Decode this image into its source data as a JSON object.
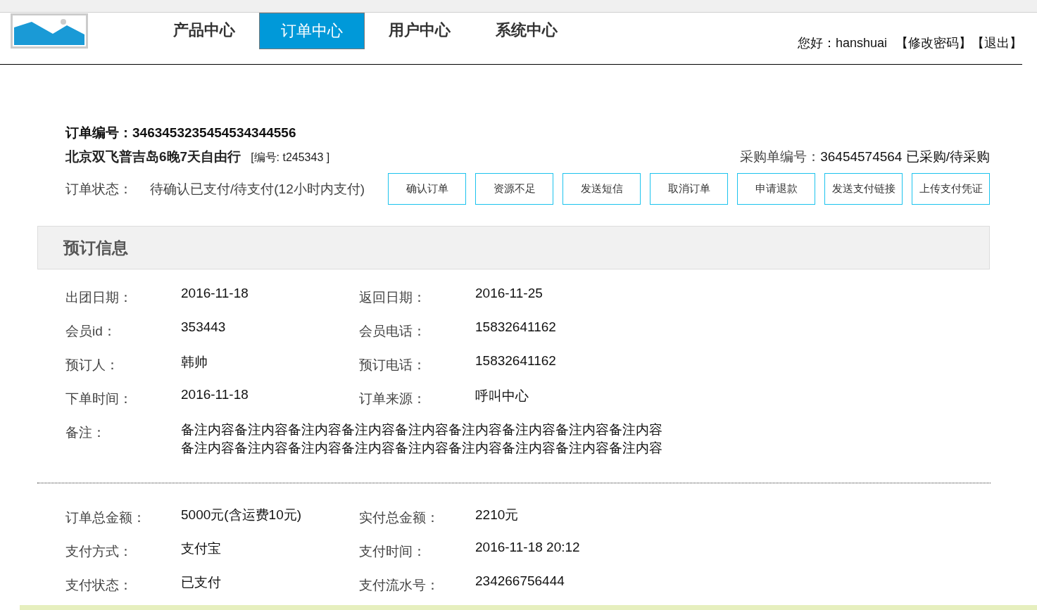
{
  "nav": {
    "tabs": [
      {
        "label": "产品中心",
        "selected": false
      },
      {
        "label": "订单中心",
        "selected": true
      },
      {
        "label": "用户中心",
        "selected": false
      },
      {
        "label": "系统中心",
        "selected": false
      }
    ],
    "greeting": "您好：hanshuai",
    "links": [
      "【修改密码】",
      "【退出】"
    ]
  },
  "order": {
    "number_label": "订单编号：",
    "number": "3463453235454534344556",
    "product": "北京双飞普吉岛6晚7天自由行",
    "product_code": "[编号: t245343 ]",
    "purchase_label": "采购单编号：",
    "purchase_value": "36454574564 已采购/待采购",
    "status_label": "订单状态：",
    "status_value": "待确认已支付/待支付(12小时内支付)",
    "buttons": [
      "确认订单",
      "资源不足",
      "发送短信",
      "取消订单",
      "申请退款",
      "发送支付链接",
      "上传支付凭证"
    ]
  },
  "booking": {
    "title": "预订信息",
    "fields": [
      {
        "label": "出团日期：",
        "value": "2016-11-18"
      },
      {
        "label": "返回日期：",
        "value": "2016-11-25"
      },
      {
        "label": "会员id：",
        "value": "353443"
      },
      {
        "label": "会员电话：",
        "value": "15832641162"
      },
      {
        "label": "预订人：",
        "value": "韩帅"
      },
      {
        "label": "预订电话：",
        "value": "15832641162"
      },
      {
        "label": "下单时间：",
        "value": "2016-11-18"
      },
      {
        "label": "订单来源：",
        "value": "呼叫中心"
      }
    ],
    "remark_label": "备注：",
    "remark": "备注内容备注内容备注内容备注内容备注内容备注内容备注内容备注内容备注内容备注内容备注内容备注内容备注内容备注内容备注内容备注内容备注内容备注内容"
  },
  "payment": {
    "fields": [
      {
        "label": "订单总金额：",
        "value": "5000元(含运费10元)"
      },
      {
        "label": "实付总金额：",
        "value": "2210元"
      },
      {
        "label": "支付方式：",
        "value": "支付宝"
      },
      {
        "label": "支付时间：",
        "value": "2016-11-18  20:12"
      },
      {
        "label": "支付状态：",
        "value": "已支付"
      },
      {
        "label": "支付流水号：",
        "value": "234266756444"
      }
    ]
  }
}
